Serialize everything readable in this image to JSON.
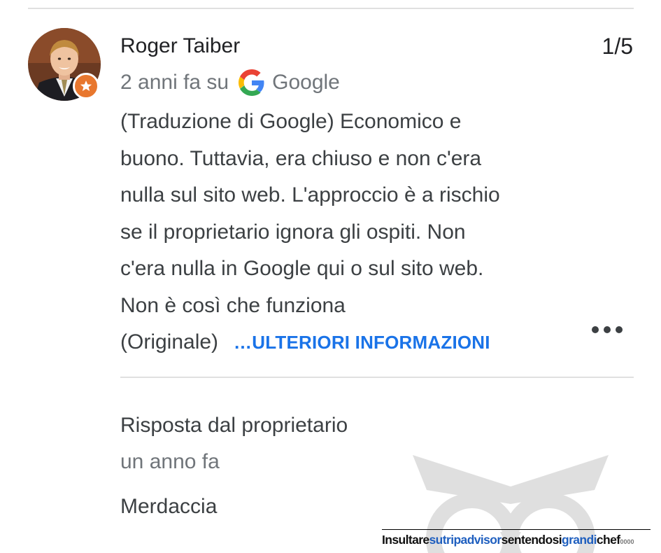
{
  "review": {
    "reviewer_name": "Roger Taiber",
    "rating": "1/5",
    "time_ago": "2 anni fa su",
    "source": "Google",
    "text_lines": [
      "(Traduzione di Google) Economico e",
      "buono. Tuttavia, era chiuso e non c'era",
      "nulla sul sito web. L'approccio è a rischio",
      "se il proprietario ignora gli ospiti. Non",
      "c'era nulla in Google qui o sul sito web.",
      "Non è così che funziona"
    ],
    "original_label": "(Originale)",
    "more_link": "…ULTERIORI INFORMAZIONI",
    "avatar_icon": "reviewer-avatar",
    "badge_icon": "local-guide-star-icon",
    "menu_icon": "more-options-icon"
  },
  "owner_response": {
    "heading": "Risposta dal proprietario",
    "time_ago": "un anno fa",
    "text": "Merdaccia"
  },
  "footer": {
    "part1": "Insultare",
    "part2": "sutripadvisor",
    "part3": "sentendosi",
    "part4": "grandi",
    "part5": "chef",
    "part6": "0000"
  },
  "colors": {
    "link": "#1a73e8",
    "badge": "#e8772e",
    "secondary_text": "#70757a"
  }
}
